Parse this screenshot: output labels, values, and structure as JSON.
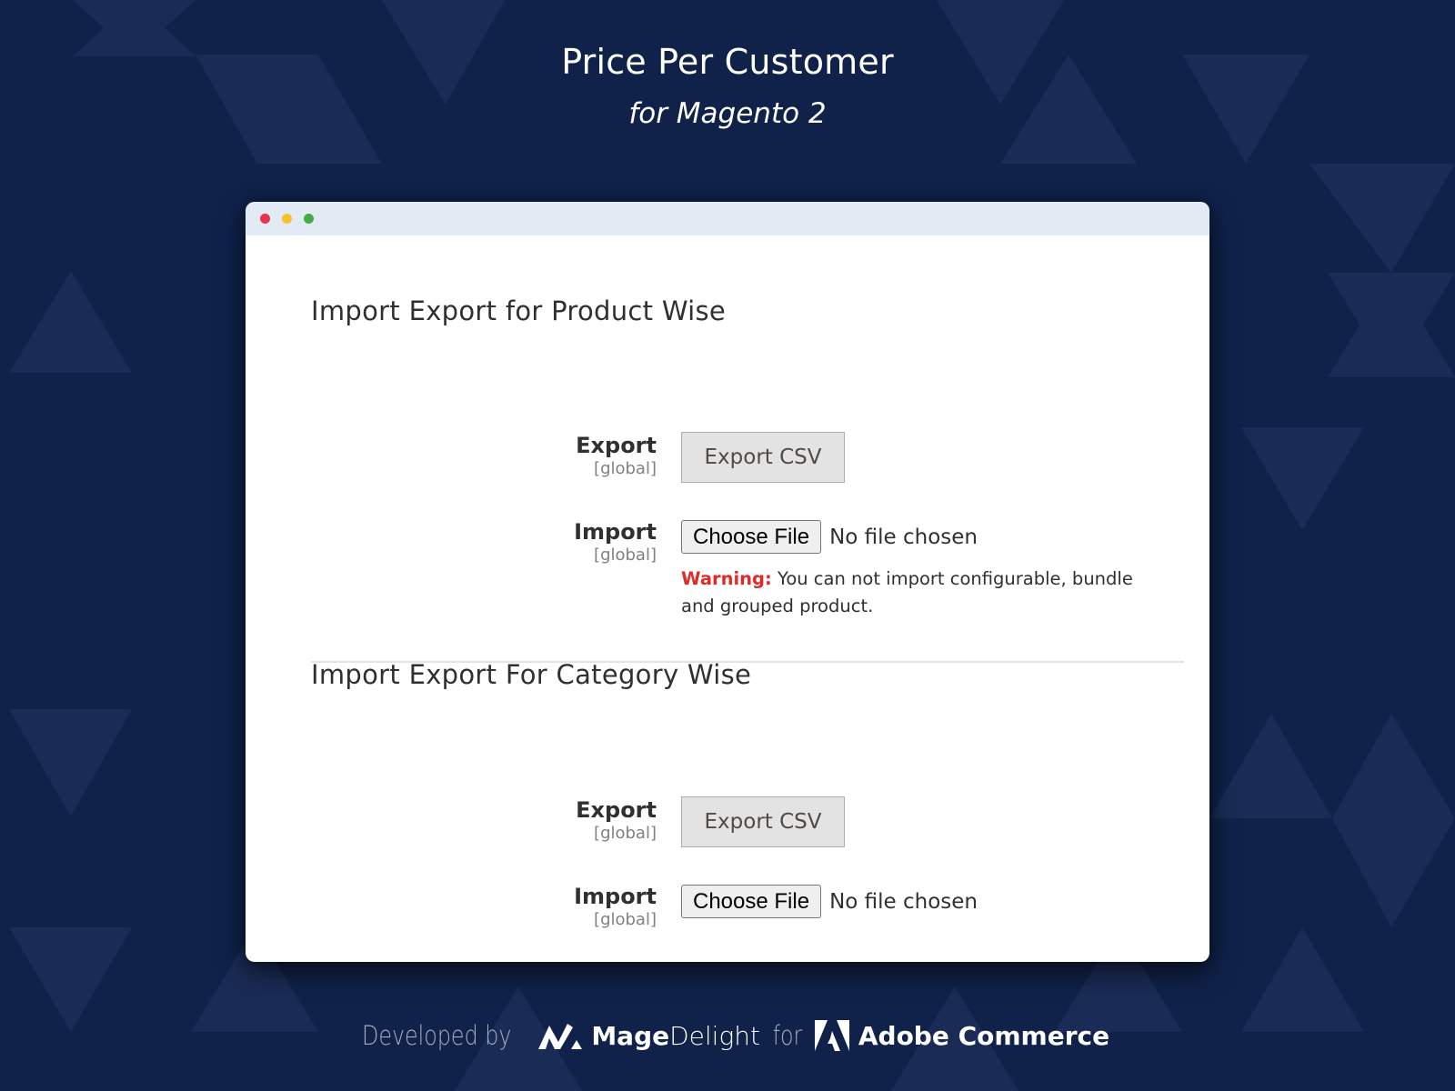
{
  "hero": {
    "title": "Price Per Customer",
    "subtitle": "for Magento 2"
  },
  "window": {
    "traffic_lights": [
      {
        "name": "close",
        "color": "#e8344b"
      },
      {
        "name": "minimize",
        "color": "#f8c12c"
      },
      {
        "name": "maximize",
        "color": "#3fae49"
      }
    ]
  },
  "sections": [
    {
      "title": "Import Export for Product Wise",
      "export": {
        "label": "Export",
        "scope": "[global]",
        "button": "Export CSV"
      },
      "import": {
        "label": "Import",
        "scope": "[global]",
        "button": "Choose File",
        "status": "No file chosen"
      },
      "warning": {
        "label": "Warning:",
        "text": " You can not import configurable, bundle and grouped product."
      }
    },
    {
      "title": "Import Export For Category Wise",
      "export": {
        "label": "Export",
        "scope": "[global]",
        "button": "Export CSV"
      },
      "import": {
        "label": "Import",
        "scope": "[global]",
        "button": "Choose File",
        "status": "No file chosen"
      }
    }
  ],
  "footer": {
    "developed_by": "Developed by",
    "brand_bold": "Mage",
    "brand_light": "Delight",
    "for": "for",
    "platform": "Adobe Commerce"
  },
  "colors": {
    "background": "#10224a",
    "pattern": "#1a2b52",
    "warning": "#e02b27",
    "titlebar": "#e2ebf3"
  }
}
